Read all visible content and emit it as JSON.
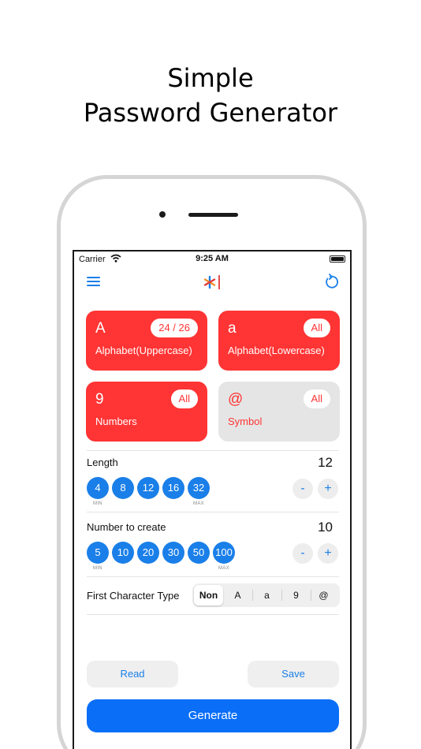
{
  "promo": {
    "title_line1": "Simple",
    "title_line2": "Password Generator"
  },
  "status_bar": {
    "carrier": "Carrier",
    "time": "9:25 AM"
  },
  "nav": {
    "menu_icon": "hamburger-menu-icon",
    "logo_icon": "app-logo-icon",
    "reset_icon": "reset-icon"
  },
  "char_types": [
    {
      "glyph": "A",
      "name": "Alphabet(Uppercase)",
      "badge": "24 / 26",
      "enabled": true
    },
    {
      "glyph": "a",
      "name": "Alphabet(Lowercase)",
      "badge": "All",
      "enabled": true
    },
    {
      "glyph": "9",
      "name": "Numbers",
      "badge": "All",
      "enabled": true
    },
    {
      "glyph": "@",
      "name": "Symbol",
      "badge": "All",
      "enabled": false
    }
  ],
  "length": {
    "label": "Length",
    "value": "12",
    "presets": [
      "4",
      "8",
      "12",
      "16",
      "32"
    ],
    "min_label": "MIN",
    "max_label": "MAX",
    "decrement": "-",
    "increment": "+"
  },
  "count": {
    "label": "Number to create",
    "value": "10",
    "presets": [
      "5",
      "10",
      "20",
      "30",
      "50",
      "100"
    ],
    "min_label": "MIN",
    "max_label": "MAX",
    "decrement": "-",
    "increment": "+"
  },
  "first_char": {
    "label": "First Character Type",
    "options": [
      "Non",
      "A",
      "a",
      "9",
      "@"
    ],
    "selected": "Non"
  },
  "actions": {
    "read": "Read",
    "save": "Save",
    "generate": "Generate"
  },
  "colors": {
    "accent": "#1a7fe8",
    "card_on": "#ff3434",
    "card_off": "#e5e5e5",
    "generate": "#0a6ef7"
  }
}
